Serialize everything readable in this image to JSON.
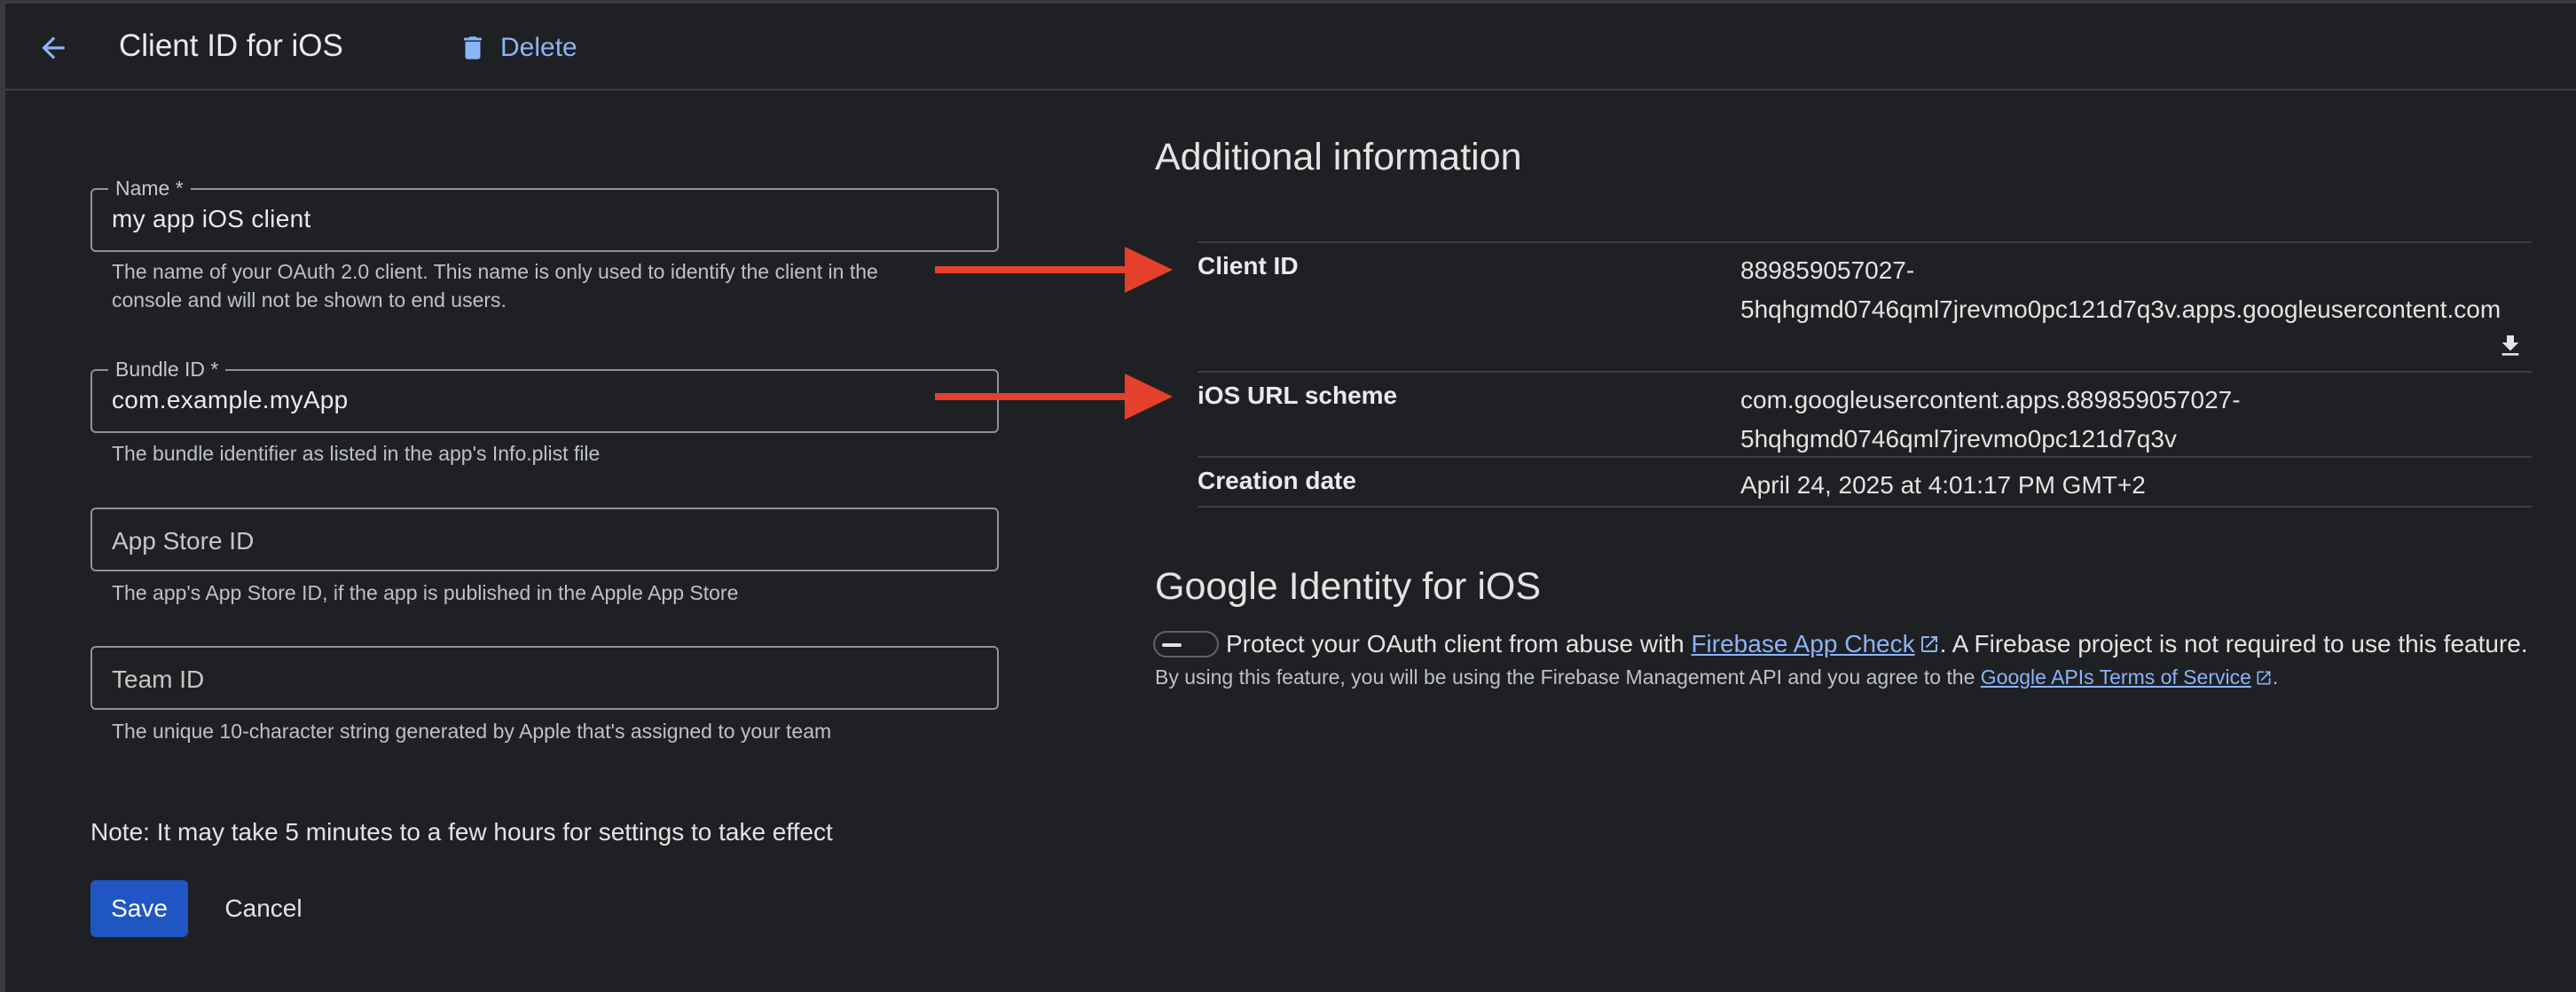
{
  "header": {
    "back_icon": "arrow-back-icon",
    "title": "Client ID for iOS",
    "delete_label": "Delete",
    "delete_icon": "trash-icon"
  },
  "form": {
    "name": {
      "label": "Name *",
      "value": "my app iOS client",
      "help_line1": "The name of your OAuth 2.0 client. This name is only used to identify the client in the",
      "help_line2": "console and will not be shown to end users."
    },
    "bundle_id": {
      "label": "Bundle ID *",
      "value": "com.example.myApp",
      "help": "The bundle identifier as listed in the app's Info.plist file"
    },
    "app_store_id": {
      "placeholder": "App Store ID",
      "help": "The app's App Store ID, if the app is published in the Apple App Store"
    },
    "team_id": {
      "placeholder": "Team ID",
      "help": "The unique 10-character string generated by Apple that's assigned to your team"
    },
    "note": "Note: It may take 5 minutes to a few hours for settings to take effect",
    "save_label": "Save",
    "cancel_label": "Cancel"
  },
  "additional_info": {
    "title": "Additional information",
    "client_id": {
      "key": "Client ID",
      "value_line1": "889859057027-",
      "value_line2": "5hqhgmd0746qml7jrevmo0pc121d7q3v.apps.googleusercontent.com",
      "download_icon": "download-icon"
    },
    "url_scheme": {
      "key": "iOS URL scheme",
      "value_line1": "com.googleusercontent.apps.889859057027-",
      "value_line2": "5hqhgmd0746qml7jrevmo0pc121d7q3v"
    },
    "creation_date": {
      "key": "Creation date",
      "value": "April 24, 2025 at 4:01:17 PM GMT+2"
    }
  },
  "google_identity": {
    "title": "Google Identity for iOS",
    "toggle_on": false,
    "protect_prefix": "Protect your OAuth client from abuse with ",
    "app_check_link": "Firebase App Check",
    "protect_suffix": ". A Firebase project is not required to use this feature.",
    "terms_prefix": "By using this feature, you will be using the Firebase Management API and you agree to the ",
    "terms_link": "Google APIs Terms of Service",
    "terms_suffix": "."
  },
  "colors": {
    "background": "#1f2023",
    "accent_link": "#8ab4f8",
    "primary_button": "#1f56c4",
    "annotation_arrow": "#e5402b"
  }
}
